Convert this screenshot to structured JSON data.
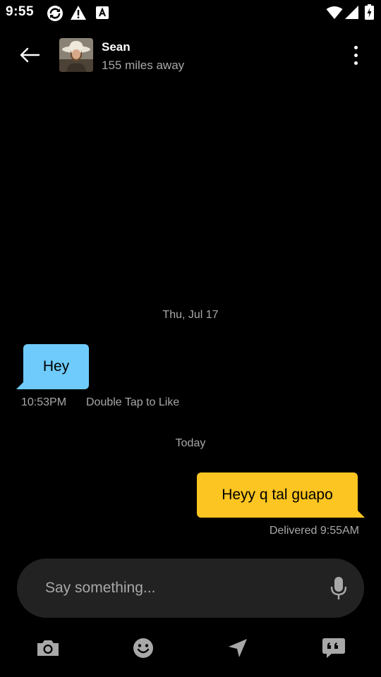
{
  "status_bar": {
    "time": "9:55",
    "left_icons": [
      "sync-icon",
      "warning-icon",
      "app-a-icon"
    ],
    "right_icons": [
      "wifi-icon",
      "signal-icon",
      "battery-icon"
    ]
  },
  "header": {
    "back_icon": "arrow-left-icon",
    "contact_name": "Sean",
    "distance": "155 miles away",
    "menu_icon": "more-vertical-icon"
  },
  "chat": {
    "messages": [
      {
        "date_label": "Thu, Jul 17",
        "direction": "incoming",
        "text": "Hey",
        "time": "10:53PM",
        "hint": "Double Tap to Like",
        "bubble_color": "#6ecbfb"
      },
      {
        "date_label": "Today",
        "direction": "outgoing",
        "text": "Heyy q tal guapo",
        "status": "Delivered 9:55AM",
        "bubble_color": "#fcc521"
      }
    ]
  },
  "composer": {
    "placeholder": "Say something...",
    "value": "",
    "mic_icon": "microphone-icon"
  },
  "toolbar": {
    "items": [
      "camera-icon",
      "emoji-icon",
      "location-arrow-icon",
      "saved-phrases-icon"
    ]
  },
  "colors": {
    "background": "#000000",
    "incoming_bubble": "#6ecbfb",
    "outgoing_bubble": "#fcc521",
    "composer_bg": "#222222",
    "muted_text": "#a8a8a8"
  }
}
